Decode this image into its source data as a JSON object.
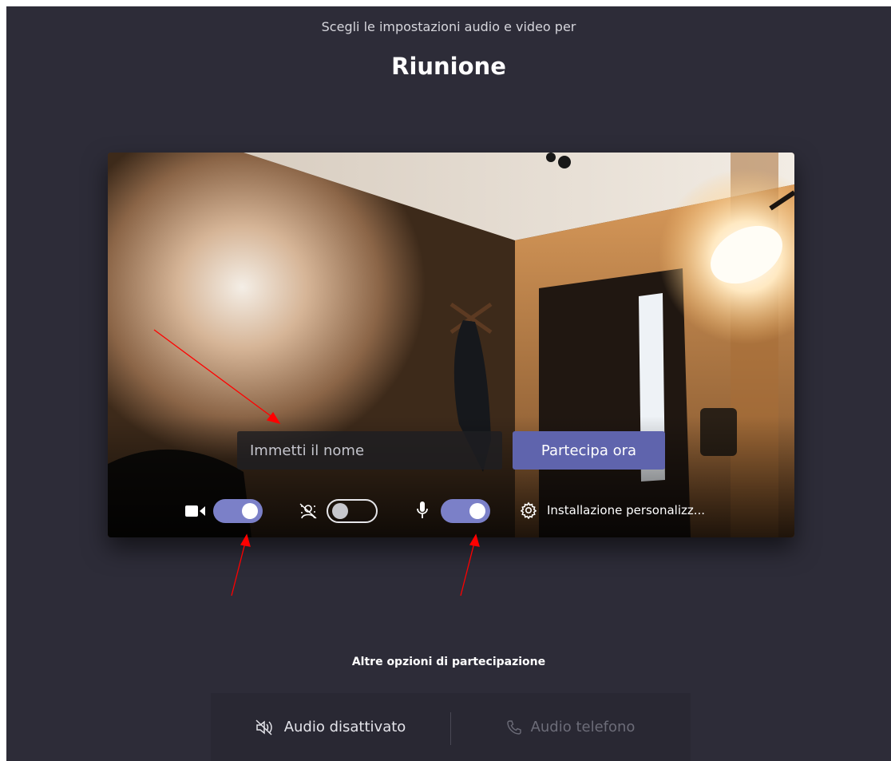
{
  "header": {
    "subtitle": "Scegli le impostazioni audio e video per",
    "meeting_title": "Riunione"
  },
  "prejoin": {
    "name_placeholder": "Immetti il nome",
    "name_value": "",
    "join_label": "Partecipa ora"
  },
  "controls": {
    "camera": {
      "icon": "camera-icon",
      "state": "on"
    },
    "background_blur": {
      "icon": "background-blur-icon",
      "state": "off"
    },
    "microphone": {
      "icon": "microphone-icon",
      "state": "on"
    },
    "custom_setup": {
      "icon": "gear-icon",
      "label": "Installazione personalizz..."
    }
  },
  "other_options": {
    "title": "Altre opzioni di partecipazione",
    "items": [
      {
        "icon": "speaker-off-icon",
        "label": "Audio disattivato",
        "enabled": true
      },
      {
        "icon": "phone-icon",
        "label": "Audio telefono",
        "enabled": false
      }
    ]
  },
  "colors": {
    "background": "#2d2c38",
    "accent": "#5f64ad",
    "toggle_on": "#7b80c8",
    "annotation_arrow": "#ff0000"
  }
}
